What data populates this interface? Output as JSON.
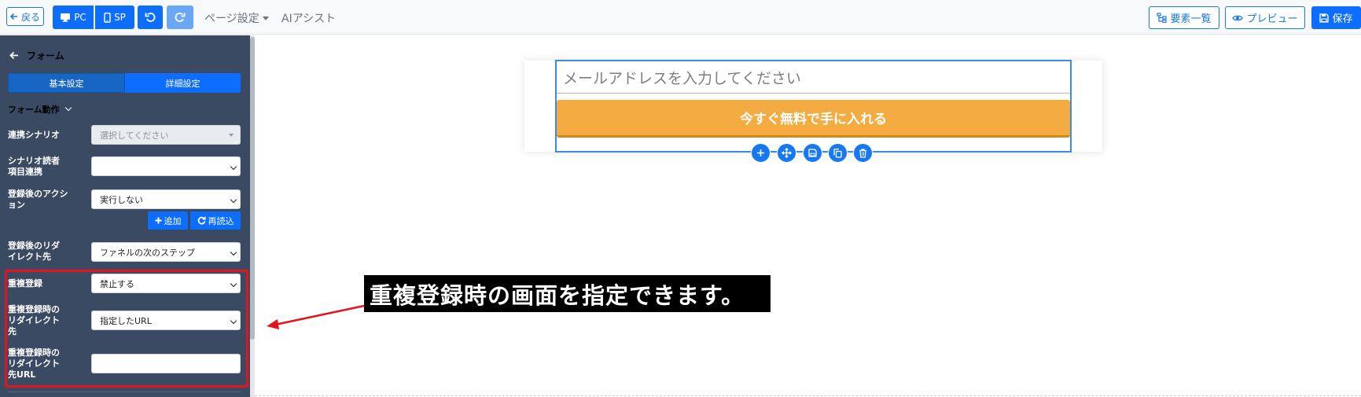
{
  "toolbar": {
    "back_label": "戻る",
    "pc_label": "PC",
    "sp_label": "SP",
    "page_settings_label": "ページ設定",
    "ai_assist_label": "AIアシスト",
    "element_list_label": "要素一覧",
    "preview_label": "プレビュー",
    "save_label": "保存",
    "accent_color": "#0d6efd"
  },
  "sidebar": {
    "title": "フォーム",
    "tabs": [
      {
        "label": "基本設定",
        "active": false
      },
      {
        "label": "詳細設定",
        "active": true
      }
    ],
    "section_title": "フォーム動作",
    "fields": {
      "scenario": {
        "label": "連携シナリオ",
        "placeholder": "選択してください"
      },
      "reader_item": {
        "label_line1": "シナリオ読者",
        "label_line2": "項目連携",
        "value": ""
      },
      "post_action": {
        "label_line1": "登録後のアクシ",
        "label_line2": "ョン",
        "value": "実行しない"
      },
      "add_button": "追加",
      "reload_button": "再読込",
      "redirect": {
        "label_line1": "登録後のリダ",
        "label_line2": "イレクト先",
        "value": "ファネルの次のステップ"
      },
      "duplicate": {
        "label": "重複登録",
        "value": "禁止する"
      },
      "dup_redirect": {
        "label_line1": "重複登録時の",
        "label_line2": "リダイレクト",
        "label_line3": "先",
        "value": "指定したURL"
      },
      "dup_redirect_url": {
        "label_line1": "重複登録時の",
        "label_line2": "リダイレクト",
        "label_line3": "先URL",
        "value": ""
      }
    },
    "background_color": "#3a4a63"
  },
  "canvas": {
    "email_placeholder": "メールアドレスを入力してください",
    "cta_label": "今すぐ無料で手に入れる",
    "cta_color": "#f4ab42",
    "tools": [
      "plus-icon",
      "move-icon",
      "save-icon",
      "copy-icon",
      "trash-icon"
    ]
  },
  "annotation": {
    "text": "重複登録時の画面を指定できます。",
    "highlight_color": "#e3141c"
  }
}
